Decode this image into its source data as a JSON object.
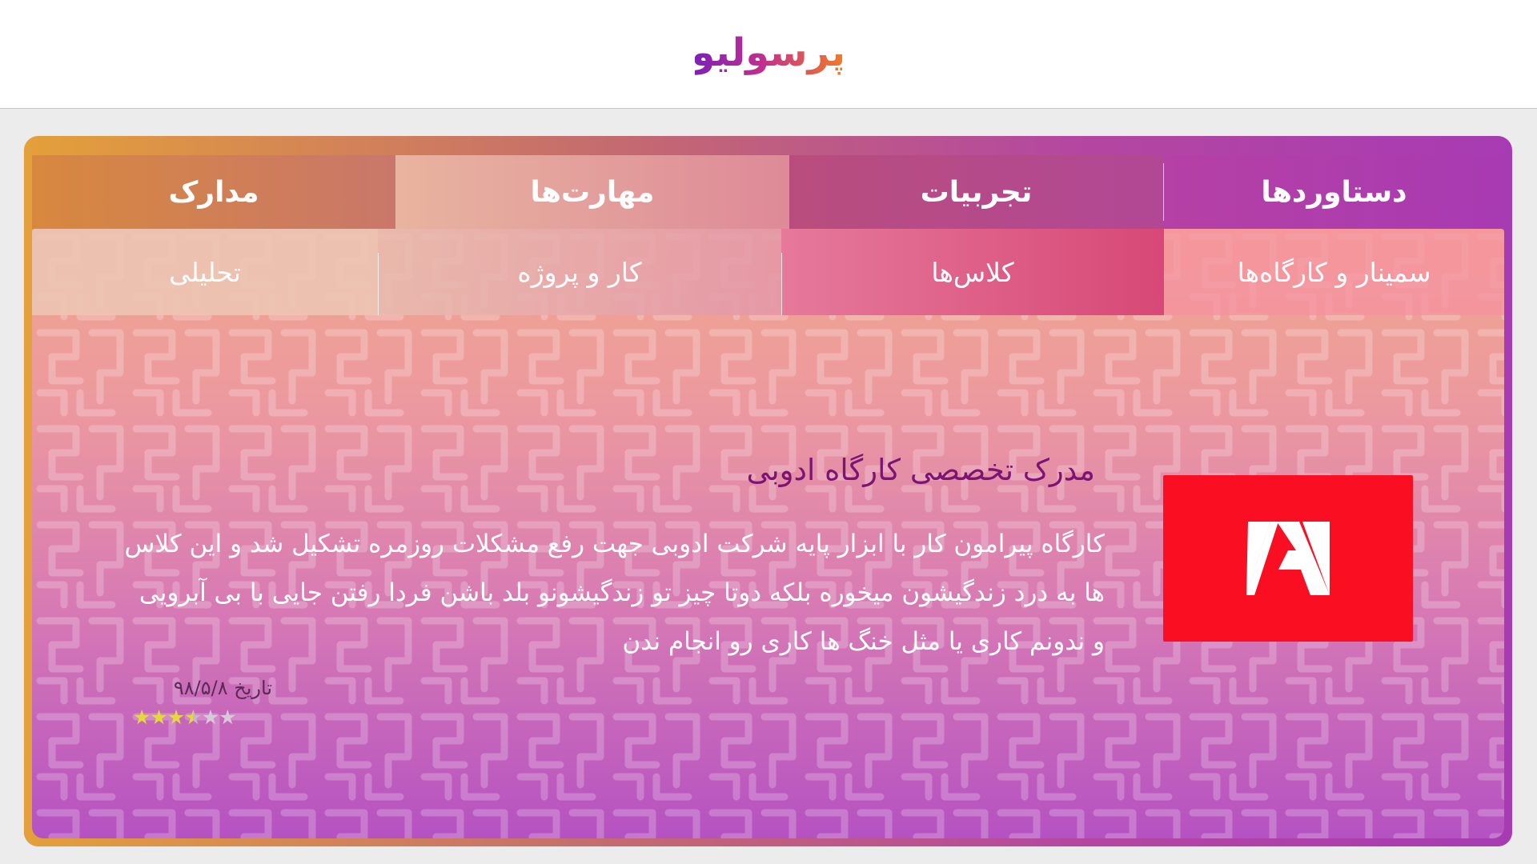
{
  "header": {
    "logo": "پرسولیو"
  },
  "tabs": [
    {
      "label": "دستاوردها"
    },
    {
      "label": "تجربیات"
    },
    {
      "label": "مهارت‌ها"
    },
    {
      "label": "مدارک"
    }
  ],
  "subtabs": [
    {
      "label": "سمینار و کارگاه‌ها"
    },
    {
      "label": "کلاس‌ها"
    },
    {
      "label": "کار و پروژه"
    },
    {
      "label": "تحلیلی"
    }
  ],
  "content": {
    "title": "مدرک تخصصی کارگاه ادوبی",
    "description": "کارگاه پیرامون کار با ابزار پایه شرکت ادوبی جهت رفع مشکلات روزمره تشکیل شد و این کلاس ها به درد زندگیشون میخوره بلکه دوتا چیز تو زندگیشونو بلد باشن فردا رفتن جایی با بی آبرویی و ندونم کاری یا مثل خنگ ها کاری رو انجام ندن",
    "date": "تاریخ ۹۸/۵/۸",
    "rating": 3.5,
    "logo_icon": "adobe-icon"
  }
}
